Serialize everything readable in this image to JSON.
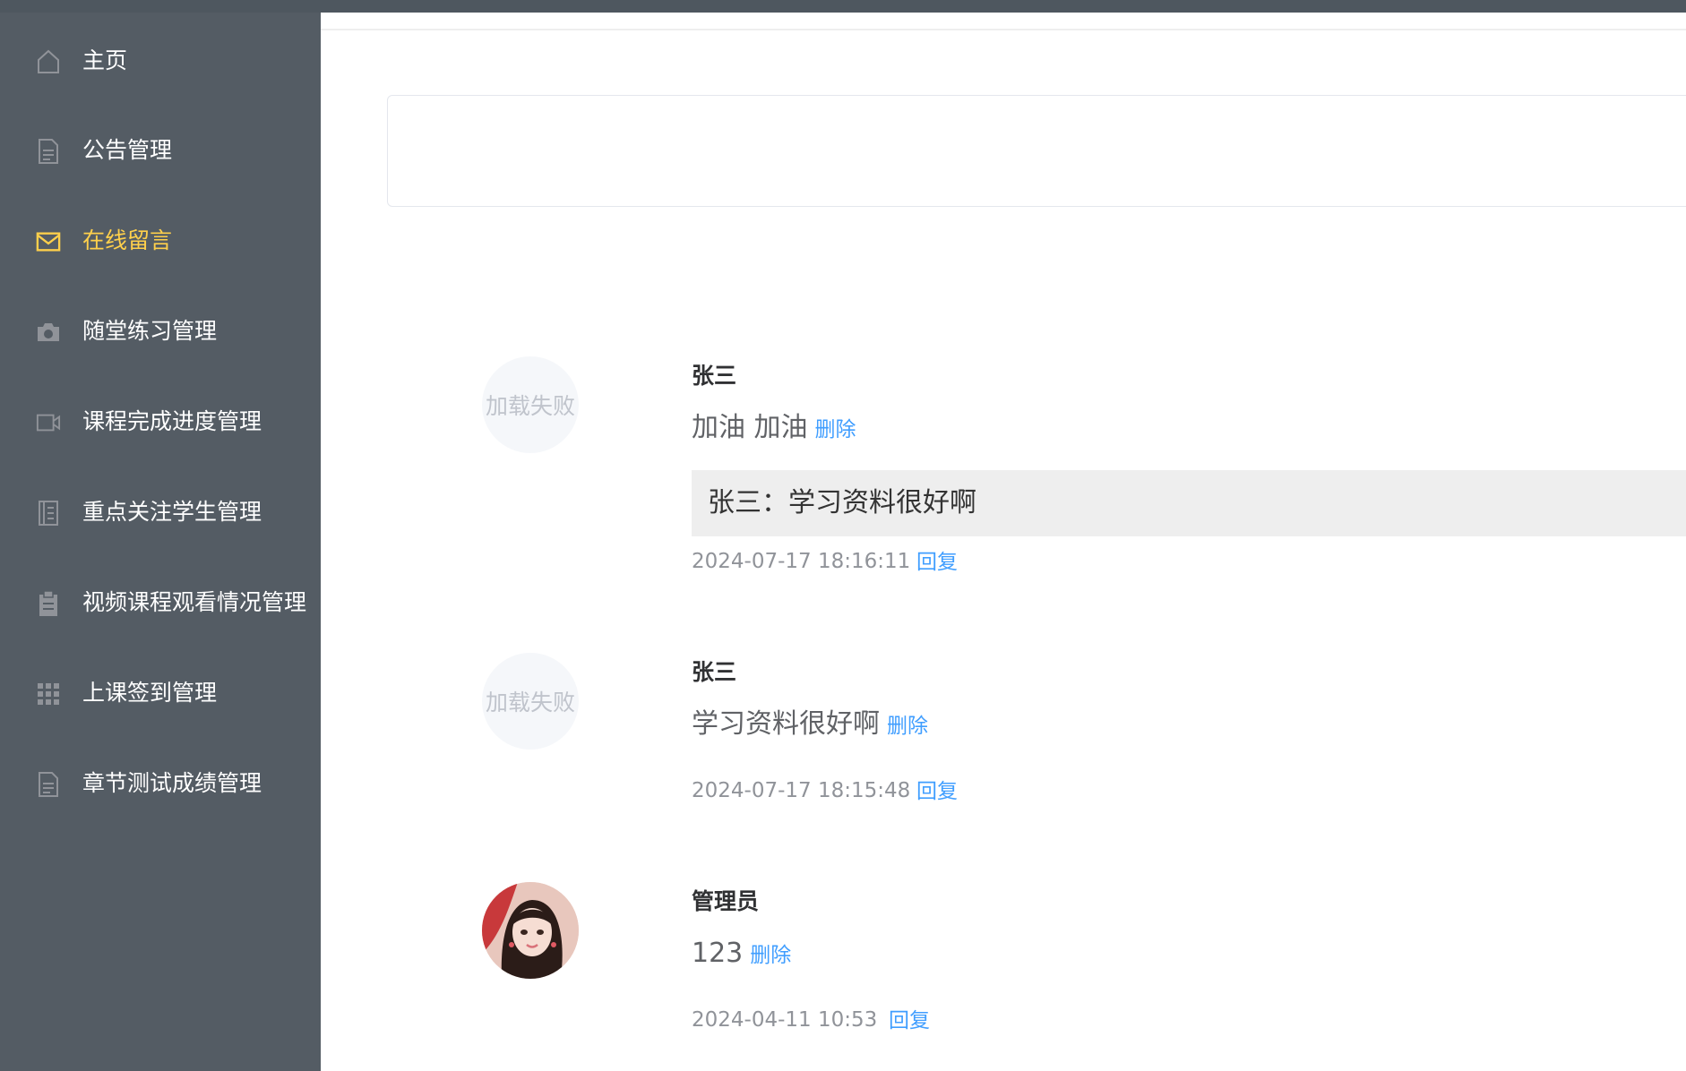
{
  "sidebar": {
    "items": [
      {
        "label": "主页",
        "icon": "home-icon"
      },
      {
        "label": "公告管理",
        "icon": "document-icon"
      },
      {
        "label": "在线留言",
        "icon": "envelope-icon",
        "active": true
      },
      {
        "label": "随堂练习管理",
        "icon": "camera-icon"
      },
      {
        "label": "课程完成进度管理",
        "icon": "video-camera-icon"
      },
      {
        "label": "重点关注学生管理",
        "icon": "notebook-icon"
      },
      {
        "label": "视频课程观看情况管理",
        "icon": "clipboard-icon"
      },
      {
        "label": "上课签到管理",
        "icon": "grid-icon"
      },
      {
        "label": "章节测试成绩管理",
        "icon": "document-icon"
      }
    ],
    "active_color": "#ffd04b",
    "background": "#545c64"
  },
  "comments": [
    {
      "name": "张三",
      "text": "加油 加油",
      "delete_label": "删除",
      "avatar_fail": "加载失败",
      "reply": "张三：学习资料很好啊",
      "time": "2024-07-17 18:16:11",
      "reply_label": "回复"
    },
    {
      "name": "张三",
      "text": "学习资料很好啊",
      "delete_label": "删除",
      "avatar_fail": "加载失败",
      "time": "2024-07-17 18:15:48",
      "reply_label": "回复"
    },
    {
      "name": "管理员",
      "text": "123",
      "delete_label": "删除",
      "time": "2024-04-11 10:53",
      "reply_label": "回复"
    }
  ],
  "link_color": "#409eff"
}
